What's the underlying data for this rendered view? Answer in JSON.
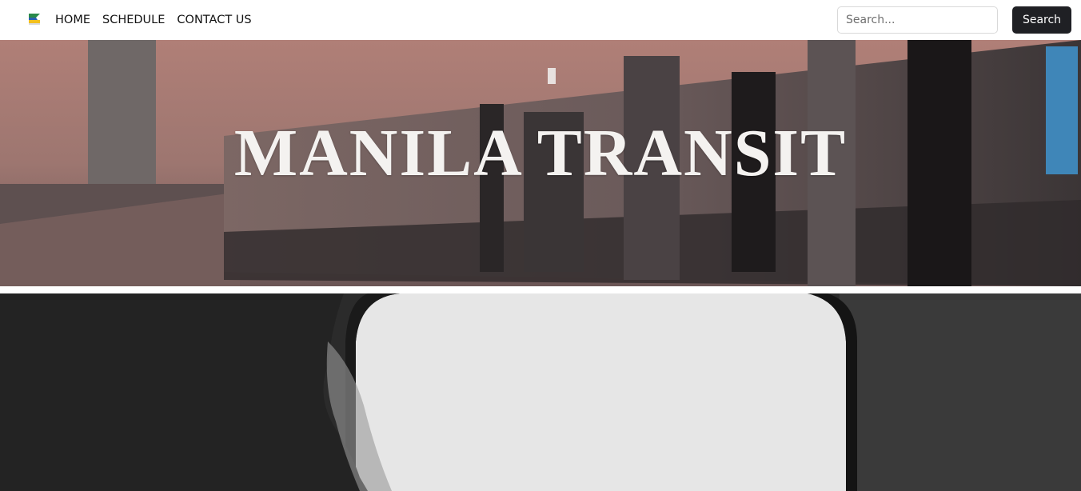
{
  "navbar": {
    "logo_icon": "manila-transit-logo-icon",
    "links": [
      {
        "label": "HOME"
      },
      {
        "label": "SCHEDULE"
      },
      {
        "label": "CONTACT US"
      }
    ],
    "search": {
      "placeholder": "Search...",
      "value": "",
      "button_label": "Search"
    }
  },
  "hero": {
    "title": "MANILA TRANSIT"
  },
  "colors": {
    "navbar_bg": "#ffffff",
    "search_button_bg": "#1f2024",
    "search_button_text": "#ffffff",
    "hero_title": "#f4f2f0"
  }
}
